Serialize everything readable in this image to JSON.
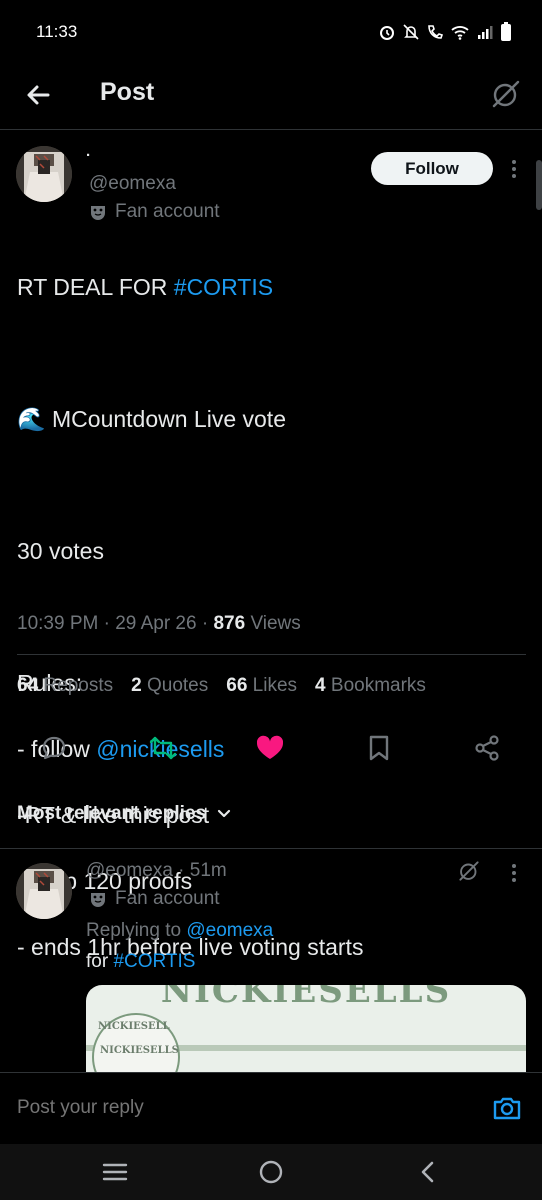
{
  "status_bar": {
    "time": "11:33",
    "icons": [
      "alarm-icon",
      "mute-icon",
      "wifi-call-icon",
      "wifi-icon",
      "signal-icon",
      "battery-icon"
    ]
  },
  "header": {
    "title": "Post",
    "back_icon": "arrow-left-icon",
    "grok_icon": "grok-icon"
  },
  "post": {
    "author_name": ".",
    "handle": "@eomexa",
    "label": "Fan account",
    "follow_label": "Follow",
    "text_line1_plain": "RT DEAL FOR ",
    "text_line1_hashtag": "#CORTIS",
    "text_line2": "🌊 MCountdown Live vote",
    "text_line3": "30 votes",
    "rules_title": "Rules:",
    "rule1_plain": "- follow ",
    "rule1_mention": "@nickiesells",
    "rule2": "-RT & like this post",
    "rule3": "- drop 120 proofs",
    "rule4": "- ends 1hr before live voting starts",
    "time": "10:39 PM",
    "date": "29 Apr 26",
    "views_count": "876",
    "views_label": "Views",
    "sep": "·"
  },
  "stats": [
    {
      "count": "64",
      "label": "Reposts"
    },
    {
      "count": "2",
      "label": "Quotes"
    },
    {
      "count": "66",
      "label": "Likes"
    },
    {
      "count": "4",
      "label": "Bookmarks"
    }
  ],
  "actions": [
    "reply-icon",
    "repost-icon",
    "like-icon",
    "bookmark-icon",
    "share-icon"
  ],
  "colors": {
    "accent": "#1d9bf0",
    "repost_active": "#00ba7c",
    "like_active": "#f91880",
    "background": "#000000",
    "divider": "#2f3336"
  },
  "replies": {
    "sort_label": "Most relevant replies",
    "items": [
      {
        "handle": "@eomexa",
        "time": "51m",
        "sep": "·",
        "label": "Fan account",
        "replying_prefix": "Replying to",
        "replying_to": "@eomexa",
        "text_plain": "for ",
        "text_hashtag": "#CORTIS",
        "media_text_big": "NICKIESELLS",
        "media_text_small_1": "NICKIESELL",
        "media_text_small_2": "NICKIESELLS"
      }
    ]
  },
  "reply_box": {
    "placeholder": "Post your reply"
  }
}
